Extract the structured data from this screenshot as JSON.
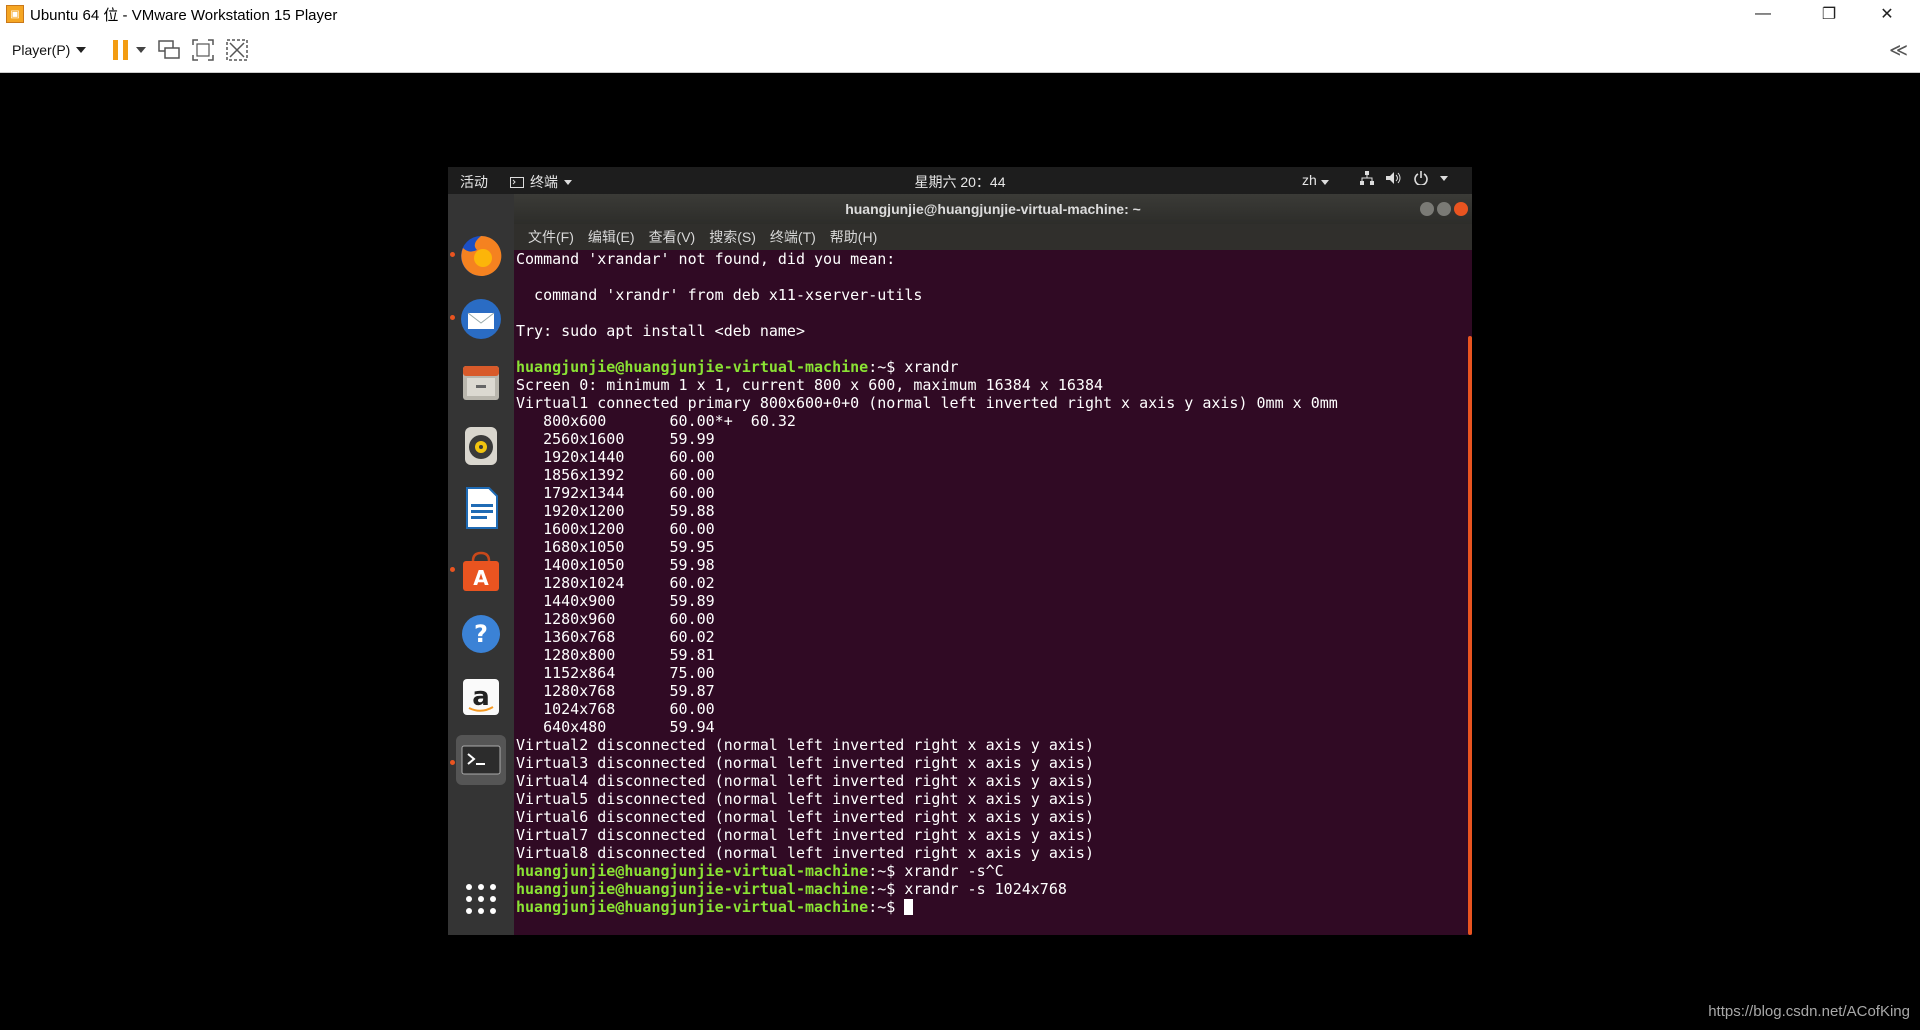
{
  "window": {
    "title": "Ubuntu 64 位 - VMware Workstation 15 Player",
    "minimize": "—",
    "restore": "❐",
    "close": "✕"
  },
  "toolbar": {
    "player_label": "Player(P)",
    "collapse_label": "≪"
  },
  "guest": {
    "topbar": {
      "activities": "活动",
      "app_menu": "终端",
      "clock": "星期六 20：44",
      "language": "zh"
    },
    "terminal": {
      "title": "huangjunjie@huangjunjie-virtual-machine: ~",
      "menu": [
        "文件(F)",
        "编辑(E)",
        "查看(V)",
        "搜索(S)",
        "终端(T)",
        "帮助(H)"
      ],
      "lines": [
        {
          "text": "Command 'xrandar' not found, did you mean:"
        },
        {
          "text": ""
        },
        {
          "text": "  command 'xrandr' from deb x11-xserver-utils"
        },
        {
          "text": ""
        },
        {
          "text": "Try: sudo apt install <deb name>"
        },
        {
          "text": ""
        },
        {
          "prompt": "huangjunjie@huangjunjie-virtual-machine",
          "text": ":~$ xrandr"
        },
        {
          "text": "Screen 0: minimum 1 x 1, current 800 x 600, maximum 16384 x 16384"
        },
        {
          "text": "Virtual1 connected primary 800x600+0+0 (normal left inverted right x axis y axis) 0mm x 0mm"
        },
        {
          "text": "   800x600       60.00*+  60.32"
        },
        {
          "text": "   2560x1600     59.99"
        },
        {
          "text": "   1920x1440     60.00"
        },
        {
          "text": "   1856x1392     60.00"
        },
        {
          "text": "   1792x1344     60.00"
        },
        {
          "text": "   1920x1200     59.88"
        },
        {
          "text": "   1600x1200     60.00"
        },
        {
          "text": "   1680x1050     59.95"
        },
        {
          "text": "   1400x1050     59.98"
        },
        {
          "text": "   1280x1024     60.02"
        },
        {
          "text": "   1440x900      59.89"
        },
        {
          "text": "   1280x960      60.00"
        },
        {
          "text": "   1360x768      60.02"
        },
        {
          "text": "   1280x800      59.81"
        },
        {
          "text": "   1152x864      75.00"
        },
        {
          "text": "   1280x768      59.87"
        },
        {
          "text": "   1024x768      60.00"
        },
        {
          "text": "   640x480       59.94"
        },
        {
          "text": "Virtual2 disconnected (normal left inverted right x axis y axis)"
        },
        {
          "text": "Virtual3 disconnected (normal left inverted right x axis y axis)"
        },
        {
          "text": "Virtual4 disconnected (normal left inverted right x axis y axis)"
        },
        {
          "text": "Virtual5 disconnected (normal left inverted right x axis y axis)"
        },
        {
          "text": "Virtual6 disconnected (normal left inverted right x axis y axis)"
        },
        {
          "text": "Virtual7 disconnected (normal left inverted right x axis y axis)"
        },
        {
          "text": "Virtual8 disconnected (normal left inverted right x axis y axis)"
        },
        {
          "prompt": "huangjunjie@huangjunjie-virtual-machine",
          "text": ":~$ xrandr -s^C"
        },
        {
          "prompt": "huangjunjie@huangjunjie-virtual-machine",
          "text": ":~$ xrandr -s 1024x768"
        },
        {
          "prompt": "huangjunjie@huangjunjie-virtual-machine",
          "text": ":~$ ",
          "cursor": true
        }
      ]
    },
    "dock": [
      "firefox-icon",
      "thunderbird-icon",
      "files-icon",
      "rhythmbox-icon",
      "libreoffice-writer-icon",
      "ubuntu-software-icon",
      "help-icon",
      "amazon-icon",
      "terminal-icon",
      "show-apps-icon"
    ]
  },
  "watermark": "https://blog.csdn.net/ACofKing",
  "colors": {
    "terminal_bg": "#300a24",
    "prompt_green": "#8ae234",
    "ubuntu_orange": "#e95420",
    "dock_bg": "#343434"
  }
}
